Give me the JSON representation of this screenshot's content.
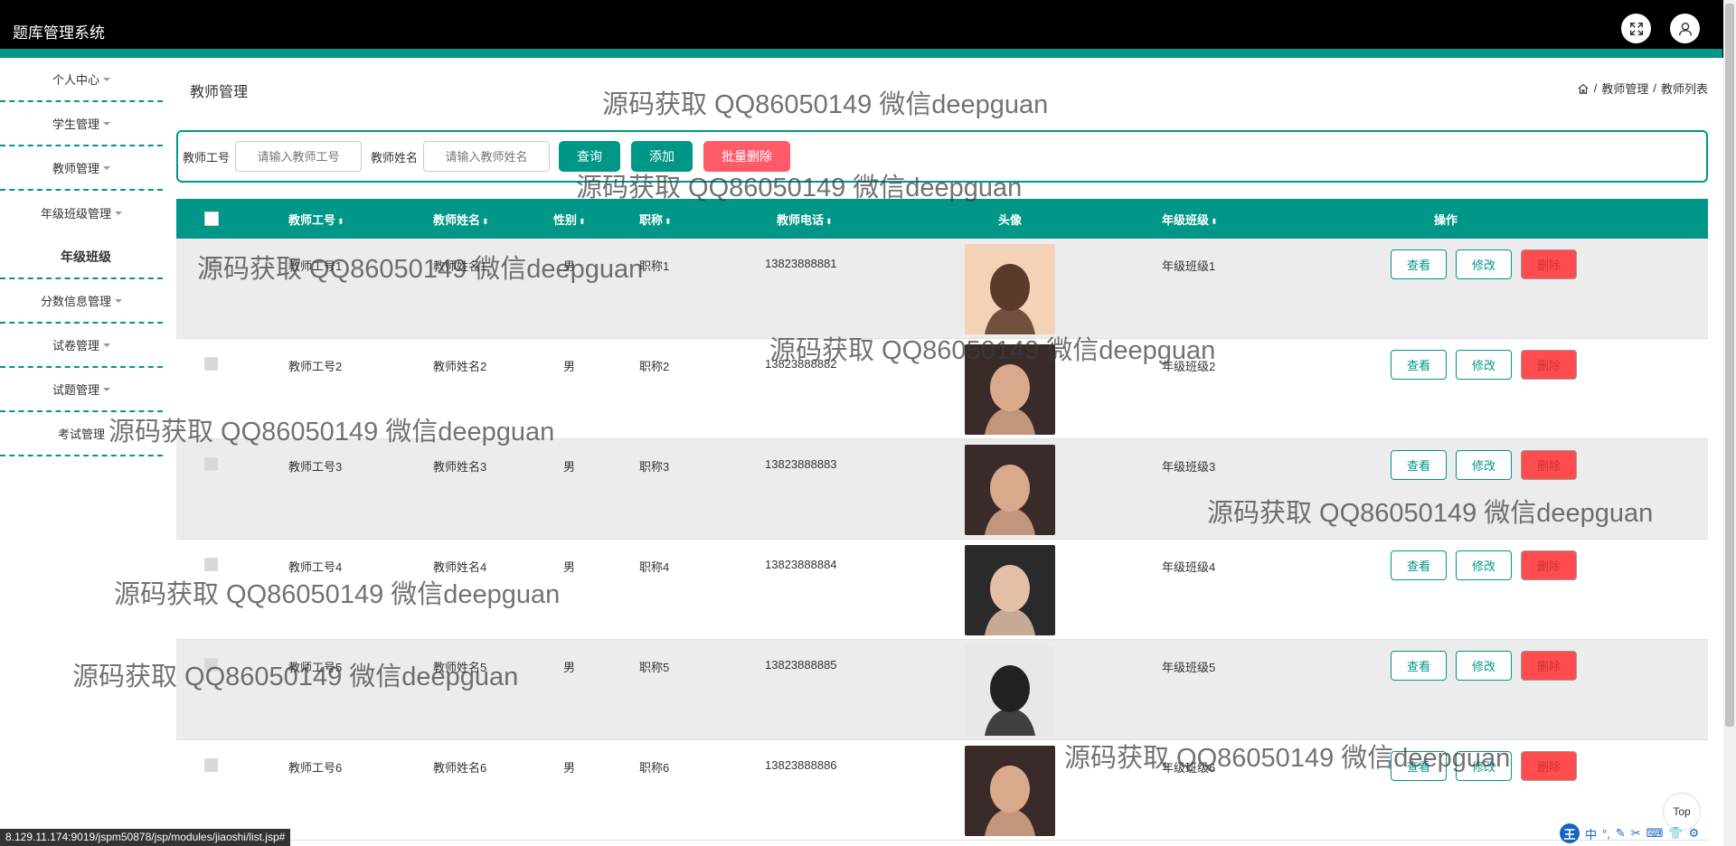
{
  "app": {
    "title": "题库管理系统"
  },
  "sidebar": {
    "items": [
      {
        "label": "个人中心"
      },
      {
        "label": "学生管理"
      },
      {
        "label": "教师管理"
      },
      {
        "label": "年级班级管理"
      },
      {
        "label": "年级班级"
      },
      {
        "label": "分数信息管理"
      },
      {
        "label": "试卷管理"
      },
      {
        "label": "试题管理"
      },
      {
        "label": "考试管理"
      }
    ]
  },
  "page": {
    "title": "教师管理",
    "breadcrumb": [
      "/",
      "教师管理",
      "/",
      "教师列表"
    ]
  },
  "search": {
    "field1_label": "教师工号",
    "field1_placeholder": "请输入教师工号",
    "field2_label": "教师姓名",
    "field2_placeholder": "请输入教师姓名",
    "query_label": "查询",
    "add_label": "添加",
    "batch_delete_label": "批量删除"
  },
  "table": {
    "headers": [
      "教师工号",
      "教师姓名",
      "性别",
      "职称",
      "教师电话",
      "头像",
      "年级班级",
      "操作"
    ],
    "rows": [
      {
        "id": "教师工号1",
        "name": "教师姓名1",
        "gender": "男",
        "title": "职称1",
        "phone": "13823888881",
        "class": "年级班级1"
      },
      {
        "id": "教师工号2",
        "name": "教师姓名2",
        "gender": "男",
        "title": "职称2",
        "phone": "13823888882",
        "class": "年级班级2"
      },
      {
        "id": "教师工号3",
        "name": "教师姓名3",
        "gender": "男",
        "title": "职称3",
        "phone": "13823888883",
        "class": "年级班级3"
      },
      {
        "id": "教师工号4",
        "name": "教师姓名4",
        "gender": "男",
        "title": "职称4",
        "phone": "13823888884",
        "class": "年级班级4"
      },
      {
        "id": "教师工号5",
        "name": "教师姓名5",
        "gender": "男",
        "title": "职称5",
        "phone": "13823888885",
        "class": "年级班级5"
      },
      {
        "id": "教师工号6",
        "name": "教师姓名6",
        "gender": "男",
        "title": "职称6",
        "phone": "13823888886",
        "class": "年级班级6"
      }
    ],
    "actions": {
      "view": "查看",
      "edit": "修改",
      "delete": "删除"
    }
  },
  "watermark": "源码获取 QQ86050149 微信deepguan",
  "status": {
    "url": "8.129.11.174:9019/jspm50878/jsp/modules/jiaoshi/list.jsp#"
  },
  "top_button": "Top",
  "ime": {
    "mode": "中"
  },
  "colors": {
    "accent": "#009688",
    "danger": "#ff4d4f",
    "topbar": "#000000"
  }
}
